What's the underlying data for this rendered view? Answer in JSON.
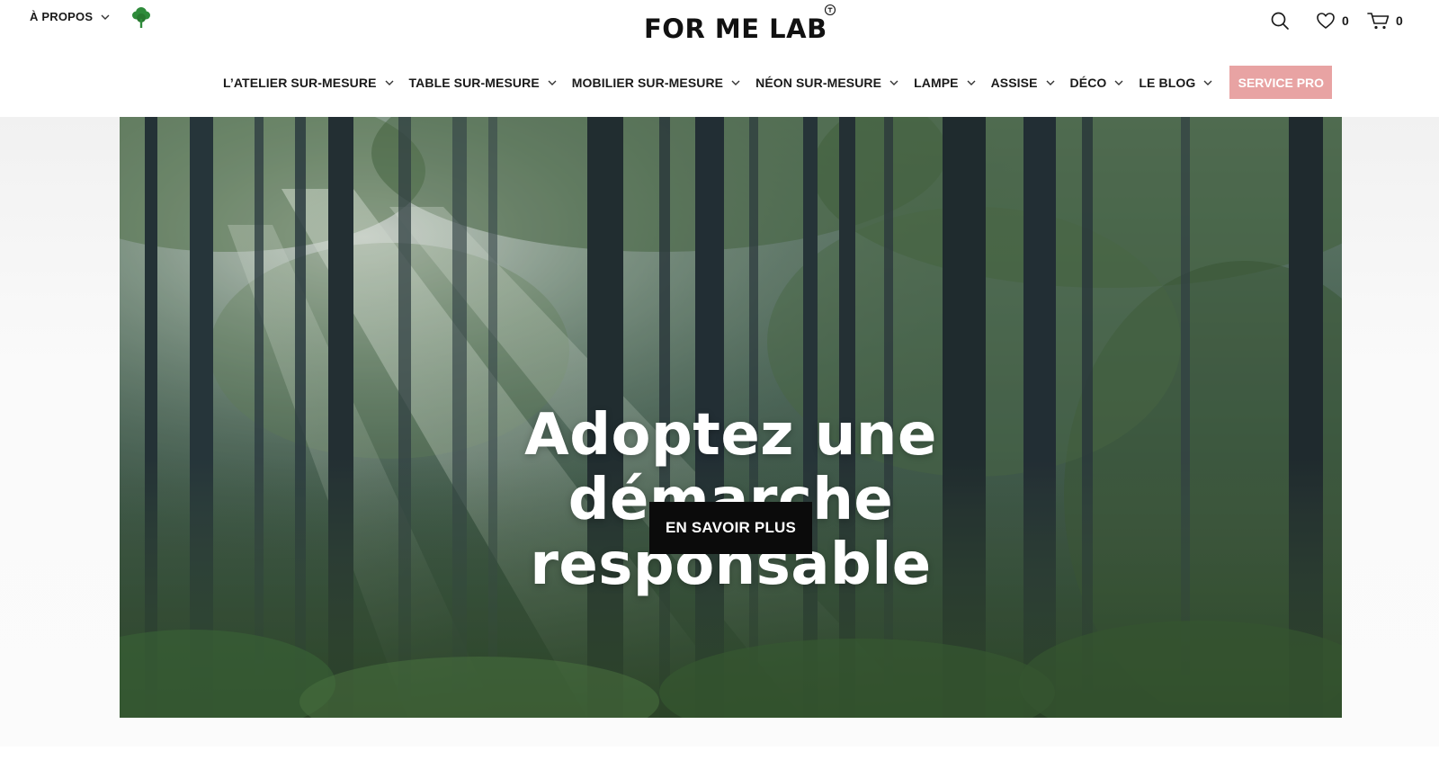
{
  "header": {
    "about_label": "À PROPOS",
    "logo_text": "FOR ME LAB",
    "wishlist_count": "0",
    "cart_count": "0"
  },
  "nav": {
    "items": [
      {
        "label": "L’ATELIER SUR-MESURE"
      },
      {
        "label": "TABLE SUR-MESURE"
      },
      {
        "label": "MOBILIER SUR-MESURE"
      },
      {
        "label": "NÉON SUR-MESURE"
      },
      {
        "label": "LAMPE"
      },
      {
        "label": "ASSISE"
      },
      {
        "label": "DÉCO"
      },
      {
        "label": "LE BLOG"
      }
    ],
    "pro_label": "SERVICE PRO"
  },
  "hero": {
    "title_lines": [
      "Adoptez une",
      "démarche",
      "responsable"
    ],
    "cta_label": "EN SAVOIR PLUS"
  },
  "colors": {
    "accent_pro": "#e8a3a3",
    "cta_bg": "#0b0b0b",
    "tree_green": "#2e8b3a"
  },
  "icons": [
    "chevron-down-icon",
    "tree-icon",
    "search-icon",
    "heart-icon",
    "cart-icon"
  ]
}
